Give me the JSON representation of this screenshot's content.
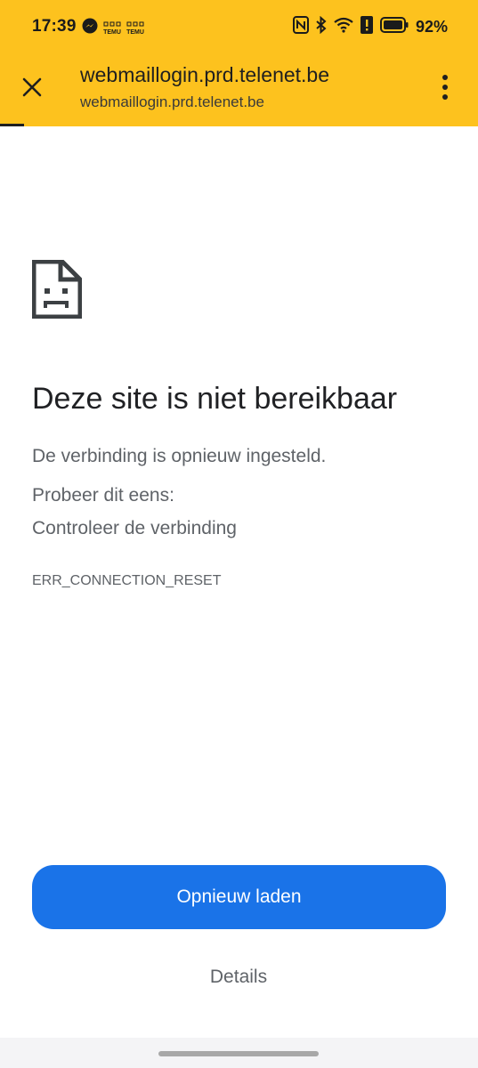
{
  "status_bar": {
    "time": "17:39",
    "temu_label": "TEMU",
    "battery_percent": "92%",
    "icons": [
      "messenger-icon",
      "temu-icon",
      "temu-icon",
      "nfc-icon",
      "bluetooth-icon",
      "wifi-icon",
      "alert-icon",
      "battery-icon"
    ]
  },
  "toolbar": {
    "title": "webmaillogin.prd.telenet.be",
    "url": "webmaillogin.prd.telenet.be",
    "close_icon": "close-icon",
    "menu_icon": "more-vert-icon",
    "load_progress": 0.05
  },
  "error_page": {
    "icon": "sad-page-icon",
    "title": "Deze site is niet bereikbaar",
    "description": "De verbinding is opnieuw ingesteld.",
    "try_label": "Probeer dit eens:",
    "suggestion": "Controleer de verbinding",
    "code": "ERR_CONNECTION_RESET"
  },
  "actions": {
    "reload_label": "Opnieuw laden",
    "details_label": "Details"
  },
  "colors": {
    "toolbar_bg": "#fdc21e",
    "primary_button": "#1a73e8",
    "secondary_text": "#5f6368"
  }
}
